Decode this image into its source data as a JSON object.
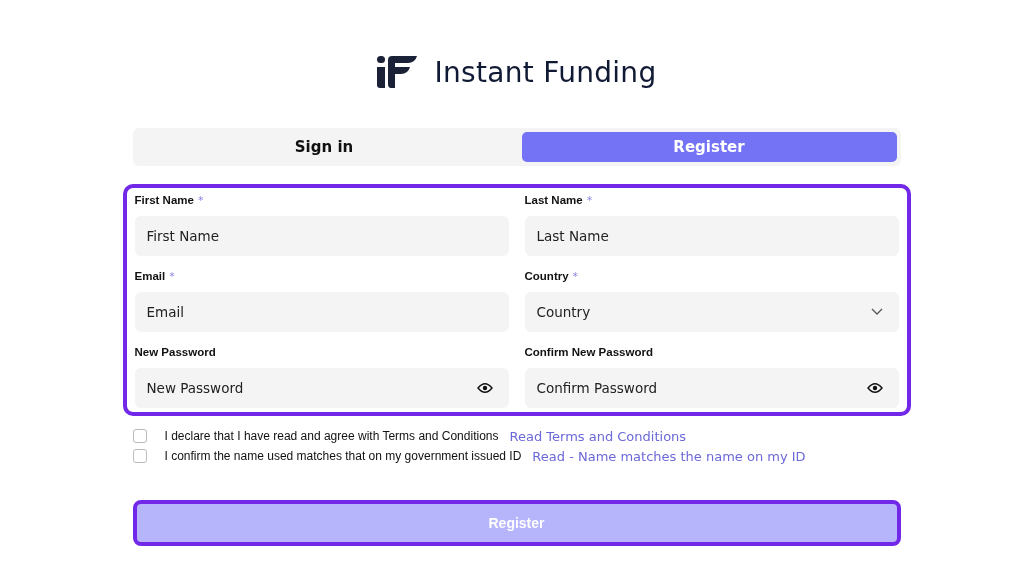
{
  "brand": {
    "name": "Instant Funding"
  },
  "tabs": [
    {
      "label": "Sign in",
      "selected": false
    },
    {
      "label": "Register",
      "selected": true
    }
  ],
  "form": {
    "highlighted": true,
    "fields": [
      {
        "label": "First Name",
        "required_mark": "*",
        "kind": "text",
        "placeholder": "First Name"
      },
      {
        "label": "Last Name",
        "required_mark": "*",
        "kind": "text",
        "placeholder": "Last Name"
      },
      {
        "label": "Email",
        "required_mark": "*",
        "kind": "text",
        "placeholder": "Email"
      },
      {
        "label": "Country",
        "required_mark": "*",
        "kind": "select",
        "placeholder": "Country"
      },
      {
        "label": "New Password",
        "kind": "password",
        "placeholder": "New Password"
      },
      {
        "label": "Confirm New Password",
        "kind": "password",
        "placeholder": "Confirm Password"
      }
    ]
  },
  "agreements": [
    {
      "text": "I declare that I have read and agree with Terms and Conditions",
      "link": "Read Terms and Conditions",
      "checked": false
    },
    {
      "text": "I confirm the name used matches that on my government issued ID",
      "link": "Read - Name matches the name on my ID",
      "checked": false
    }
  ],
  "submit": {
    "label": "Register",
    "disabled": true,
    "highlighted": true
  }
}
